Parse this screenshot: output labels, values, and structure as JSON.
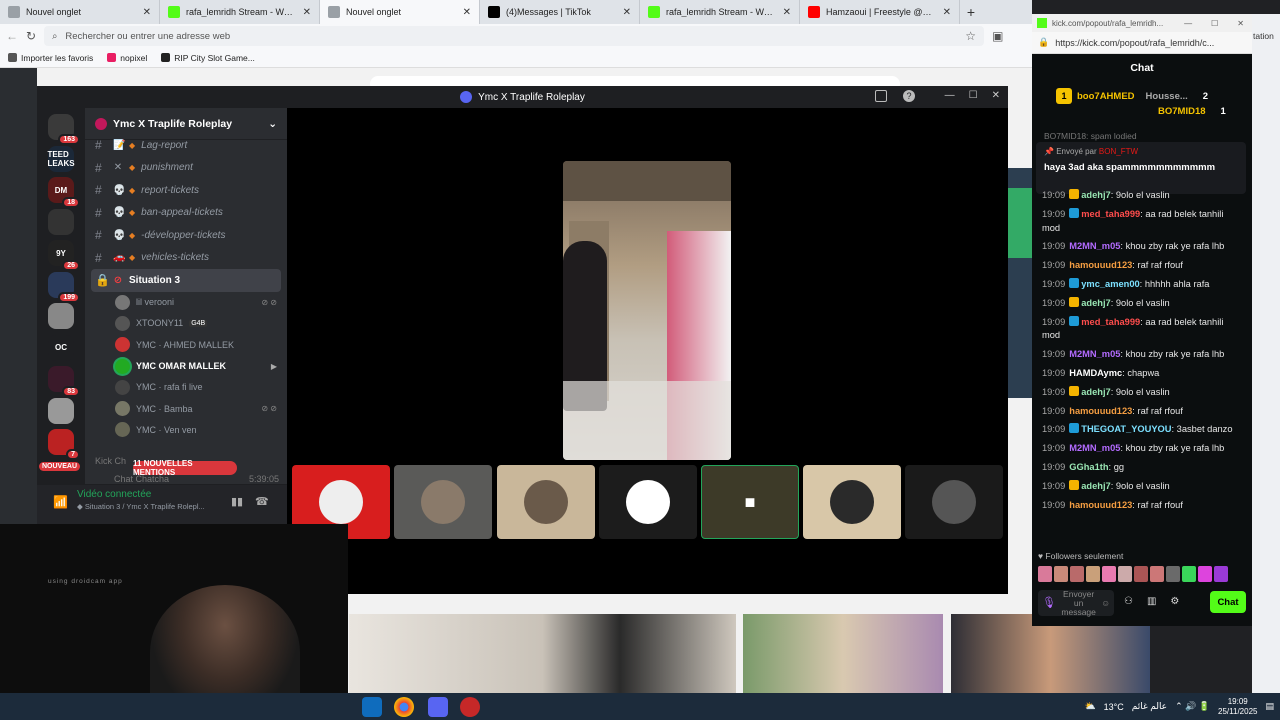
{
  "browser": {
    "tabs": [
      {
        "title": "Nouvel onglet",
        "color": "#9aa0a6"
      },
      {
        "title": "rafa_lemridh Stream - Watch Live",
        "color": "#53fc18"
      },
      {
        "title": "Nouvel onglet",
        "color": "#9aa0a6",
        "active": true
      },
      {
        "title": "(4)Messages | TikTok",
        "color": "#000000"
      },
      {
        "title": "rafa_lemridh Stream - Watch Live",
        "color": "#53fc18"
      },
      {
        "title": "Hamzaoui | Freestyle @Rachma R",
        "color": "#ff0000"
      }
    ],
    "address_placeholder": "Rechercher ou entrer une adresse web",
    "bookmarks": [
      "Importer les favoris",
      "nopixel",
      "RIP City Slot Game..."
    ],
    "right_label": "tation"
  },
  "discord": {
    "title": "Ymc X Traplife Roleplay",
    "guild": "Ymc X Traplife Roleplay",
    "channels": [
      {
        "icon": "📝",
        "name": "Lag-report"
      },
      {
        "icon": "✕",
        "name": "punishment"
      },
      {
        "icon": "💀",
        "name": "report-tickets"
      },
      {
        "icon": "💀",
        "name": "ban-appeal-tickets"
      },
      {
        "icon": "💀",
        "name": "-développer-tickets"
      },
      {
        "icon": "🚗",
        "name": "vehicles-tickets"
      }
    ],
    "voice_channel": "Situation 3",
    "voice_users": [
      {
        "name": "lil verooni",
        "color": "#777"
      },
      {
        "name": "XTOONY11",
        "tag": "G4B",
        "color": "#555"
      },
      {
        "name": "YMC · AHMED MALLEK",
        "color": "#c33"
      },
      {
        "name": "YMC   OMAR MALLEK",
        "color": "#2a2",
        "speaking": true
      },
      {
        "name": "YMC · rafa fi live",
        "color": "#444"
      },
      {
        "name": "YMC · Bamba",
        "color": "#776"
      },
      {
        "name": "YMC · Ven ven",
        "color": "#665"
      }
    ],
    "servers": [
      {
        "label": "",
        "badge": "163",
        "color": "#3a3a3a"
      },
      {
        "label": "TEED LEAKS",
        "badge": "",
        "color": "#1b2838"
      },
      {
        "label": "DM",
        "badge": "18",
        "color": "#5a1a1a"
      },
      {
        "label": "",
        "badge": "",
        "color": "#333"
      },
      {
        "label": "9Y",
        "badge": "26",
        "color": "#222"
      },
      {
        "label": "",
        "badge": "199",
        "color": "#2a3a5a"
      },
      {
        "label": "",
        "badge": "",
        "color": "#888"
      },
      {
        "label": "OC",
        "badge": "",
        "color": "#1e1f22"
      },
      {
        "label": "",
        "badge": "83",
        "color": "#3a1a2a"
      },
      {
        "label": "",
        "badge": "",
        "color": "#999"
      },
      {
        "label": "",
        "badge": "7",
        "color": "#b22"
      }
    ],
    "nouveau": "NOUVEAU",
    "kick_channel": "Kick Ch",
    "chat_channel": "Chat Chatcha",
    "time_small": "5:39:05",
    "mentions": "11 NOUVELLES MENTIONS",
    "voice_status": "Vidéo connectée",
    "voice_sub": "◆ Situation 3 / Ymc X Traplife Rolepl..."
  },
  "webcam": {
    "watermark": "using droidcam app"
  },
  "kick": {
    "window_url_short": "kick.com/popout/rafa_lemridh...",
    "url": "https://kick.com/popout/rafa_lemridh/c...",
    "header": "Chat",
    "leaderboard": [
      {
        "rank": "1",
        "name": "boo7AHMED",
        "color": "#f5c300"
      },
      {
        "rank": "",
        "name": "Housse...",
        "count": "2",
        "color": "#aaa"
      },
      {
        "rank": "",
        "name": "BO7MID18",
        "count": "1",
        "color": "#f5c300"
      }
    ],
    "pinned_by_label": "Envoyé par",
    "pinned_by": "BON_FTW",
    "pinned_msg": "haya 3ad aka spammmmmmmmmmm",
    "scroll_prev": "BO7MID18: spam lodied",
    "messages": [
      {
        "time": "19:09",
        "user": "adehj7",
        "color": "#9ae6b4",
        "badge": "#f5b400",
        "text": "9olo el vaslin"
      },
      {
        "time": "19:09",
        "user": "med_taha999",
        "color": "#ff4d4d",
        "badge": "#1e9bd7",
        "text": "aa rad belek tanhili mod"
      },
      {
        "time": "19:09",
        "user": "M2MN_m05",
        "color": "#b36bff",
        "badge": "",
        "text": "khou zby rak ye rafa lhb"
      },
      {
        "time": "19:09",
        "user": "hamouuud123",
        "color": "#f59e42",
        "badge": "",
        "text": "raf raf rfouf"
      },
      {
        "time": "19:09",
        "user": "ymc_amen00",
        "color": "#7ce0ff",
        "badge": "#1e9bd7",
        "text": "hhhhh ahla rafa"
      },
      {
        "time": "19:09",
        "user": "adehj7",
        "color": "#9ae6b4",
        "badge": "#f5b400",
        "text": "9olo el vaslin"
      },
      {
        "time": "19:09",
        "user": "med_taha999",
        "color": "#ff4d4d",
        "badge": "#1e9bd7",
        "text": "aa rad belek tanhili mod"
      },
      {
        "time": "19:09",
        "user": "M2MN_m05",
        "color": "#b36bff",
        "badge": "",
        "text": "khou zby rak ye rafa lhb"
      },
      {
        "time": "19:09",
        "user": "HAMDAymc",
        "color": "#ffffff",
        "badge": "",
        "text": "chapwa"
      },
      {
        "time": "19:09",
        "user": "adehj7",
        "color": "#9ae6b4",
        "badge": "#f5b400",
        "text": "9olo el vaslin"
      },
      {
        "time": "19:09",
        "user": "hamouuud123",
        "color": "#f59e42",
        "badge": "",
        "text": "raf raf rfouf"
      },
      {
        "time": "19:09",
        "user": "THEGOAT_YOUYOU",
        "color": "#7ce0ff",
        "badge": "#1e9bd7",
        "text": "3asbet danzo"
      },
      {
        "time": "19:09",
        "user": "M2MN_m05",
        "color": "#b36bff",
        "badge": "",
        "text": "khou zby rak ye rafa lhb"
      },
      {
        "time": "19:09",
        "user": "GGha1th",
        "color": "#9ae6b4",
        "badge": "",
        "text": "gg"
      },
      {
        "time": "19:09",
        "user": "adehj7",
        "color": "#9ae6b4",
        "badge": "#f5b400",
        "text": "9olo el vaslin"
      },
      {
        "time": "19:09",
        "user": "hamouuud123",
        "color": "#f59e42",
        "badge": "",
        "text": "raf raf rfouf"
      }
    ],
    "followers_only": "Followers seulement",
    "input_placeholder": "Envoyer un message",
    "chat_button": "Chat"
  },
  "taskbar": {
    "weather": "13°C",
    "weather_text": "عالم غائم",
    "time": "19:09",
    "date": "25/11/2025"
  }
}
